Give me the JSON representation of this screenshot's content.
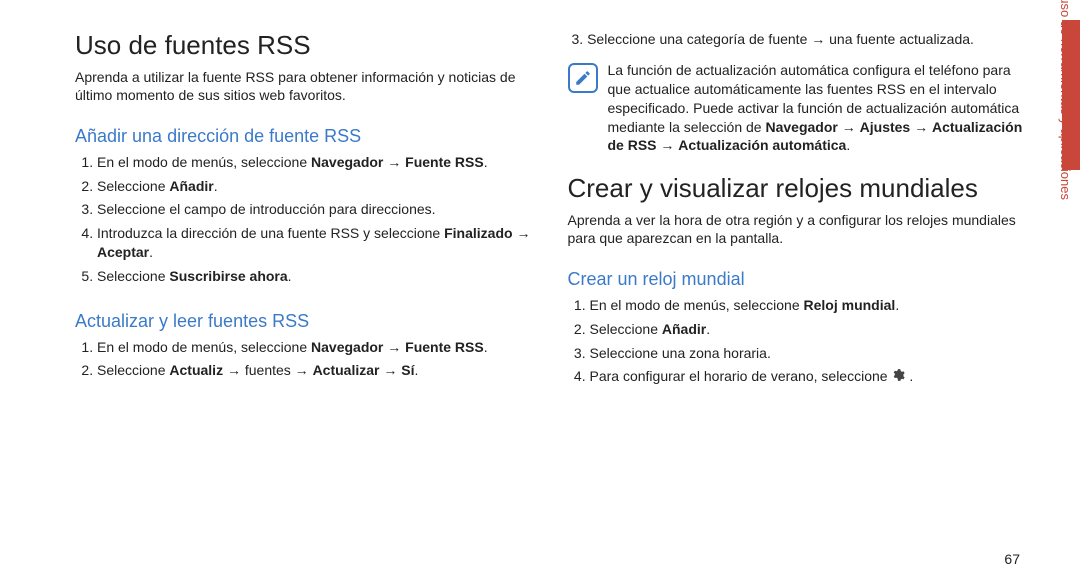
{
  "left": {
    "h1": "Uso de fuentes RSS",
    "intro": "Aprenda a utilizar la fuente RSS para obtener información y noticias de último momento de sus sitios web favoritos.",
    "sec1": {
      "title": "Añadir una dirección de fuente RSS",
      "steps": [
        {
          "pre": "En el modo de menús, seleccione ",
          "b1": "Navegador",
          "arrow": " → ",
          "b2": "Fuente RSS",
          "post": "."
        },
        {
          "pre": "Seleccione ",
          "b1": "Añadir",
          "post": "."
        },
        {
          "pre": "Seleccione el campo de introducción para direcciones."
        },
        {
          "pre": "Introduzca la dirección de una fuente RSS y seleccione ",
          "b1": "Finalizado",
          "arrow": " → ",
          "b2": "Aceptar",
          "post": "."
        },
        {
          "pre": "Seleccione ",
          "b1": "Suscribirse ahora",
          "post": "."
        }
      ]
    },
    "sec2": {
      "title": "Actualizar y leer fuentes RSS",
      "steps": [
        {
          "pre": "En el modo de menús, seleccione ",
          "b1": "Navegador",
          "arrow": " → ",
          "b2": "Fuente RSS",
          "post": "."
        },
        {
          "pre": "Seleccione ",
          "b1": "Actualiz",
          "mid": " → fuentes → ",
          "b2": "Actualizar",
          "arrow2": " → ",
          "b3": "Sí",
          "post": "."
        }
      ]
    }
  },
  "right": {
    "step3": {
      "num": "3.",
      "text": "Seleccione una categoría de fuente → una fuente actualizada."
    },
    "note": "La función de actualización automática configura el teléfono para que actualice automáticamente las fuentes RSS en el intervalo especificado. Puede activar la función de actualización automática mediante la selección de ",
    "noteBolds": {
      "b1": "Navegador",
      "a1": " → ",
      "b2": "Ajustes",
      "a2": " → ",
      "b3": "Actualización de RSS",
      "a3": " → ",
      "b4": "Actualización automática",
      "post": "."
    },
    "h1b": "Crear y visualizar relojes mundiales",
    "intro2": "Aprenda a ver la hora de otra región y a configurar los relojes mundiales para que aparezcan en la pantalla.",
    "sec3": {
      "title": "Crear un reloj mundial",
      "steps": [
        {
          "pre": "En el modo de menús, seleccione ",
          "b1": "Reloj mundial",
          "post": "."
        },
        {
          "pre": "Seleccione ",
          "b1": "Añadir",
          "post": "."
        },
        {
          "pre": "Seleccione una zona horaria."
        },
        {
          "pre": "Para configurar el horario de verano, seleccione ",
          "icon": true,
          "post": " ."
        }
      ]
    }
  },
  "sideLabel": "uso de herramientas y aplicaciones",
  "pageNumber": "67"
}
